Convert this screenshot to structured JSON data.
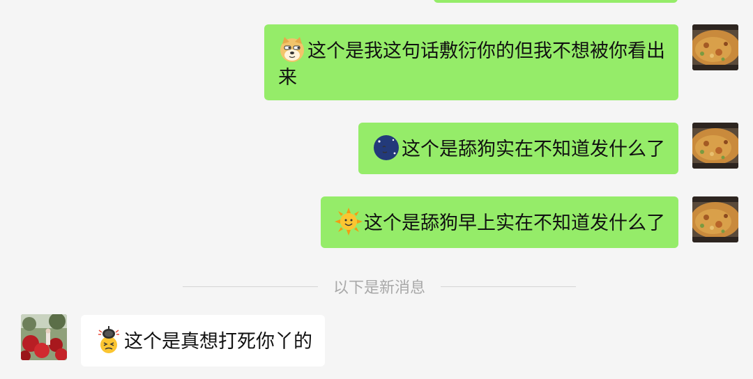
{
  "messages": [
    {
      "side": "right",
      "emoji": "doge-emoji",
      "text": "这个是我这句话敷衍你的但我不想被你看出来"
    },
    {
      "side": "right",
      "emoji": "moon-face-emoji",
      "text": "这个是舔狗实在不知道发什么了"
    },
    {
      "side": "right",
      "emoji": "sun-face-emoji",
      "text": "这个是舔狗早上实在不知道发什么了"
    }
  ],
  "divider": {
    "label": "以下是新消息"
  },
  "incoming": {
    "side": "left",
    "emoji": "frying-pan-emoji",
    "text": "这个是真想打死你丫的"
  },
  "colors": {
    "background": "#f5f5f5",
    "sent_bubble": "#95ec69",
    "received_bubble": "#ffffff",
    "divider_text": "#a8a8a8"
  }
}
